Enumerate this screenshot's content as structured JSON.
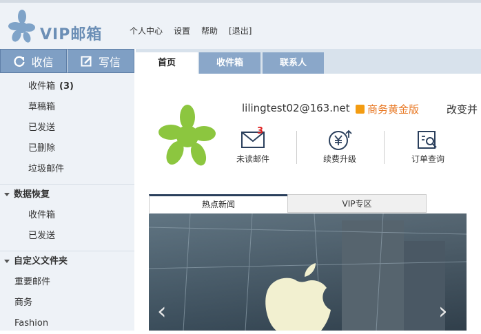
{
  "header": {
    "logo_text": "VIP邮箱",
    "links": [
      "个人中心",
      "设置",
      "帮助",
      "[退出]"
    ]
  },
  "sidebar": {
    "receive_label": "收信",
    "write_label": "写信",
    "folders": [
      {
        "label": "收件箱",
        "count": "(3)"
      },
      {
        "label": "草稿箱"
      },
      {
        "label": "已发送"
      },
      {
        "label": "已删除"
      },
      {
        "label": "垃圾邮件"
      }
    ],
    "recovery": {
      "title": "数据恢复",
      "items": [
        "收件箱",
        "已发送"
      ]
    },
    "custom": {
      "title": "自定义文件夹",
      "items": [
        "重要邮件",
        "商务",
        "Fashion"
      ]
    }
  },
  "tabs": [
    "首页",
    "收件箱",
    "联系人"
  ],
  "profile": {
    "email": "lilingtest02@163.net",
    "edition": "商务黄金版",
    "change": "改变并"
  },
  "quick_actions": [
    {
      "label": "未读邮件",
      "badge": "3",
      "icon": "envelope-icon"
    },
    {
      "label": "续费升级",
      "icon": "yen-upgrade-icon"
    },
    {
      "label": "订单查询",
      "icon": "order-search-icon"
    }
  ],
  "news_tabs": [
    "热点新闻",
    "VIP专区"
  ],
  "colors": {
    "accent": "#7f9fc4",
    "tab_inactive": "#8aa7c9",
    "edition": "#e87722",
    "badge": "#e02020",
    "logo_green": "#8cc63f"
  }
}
